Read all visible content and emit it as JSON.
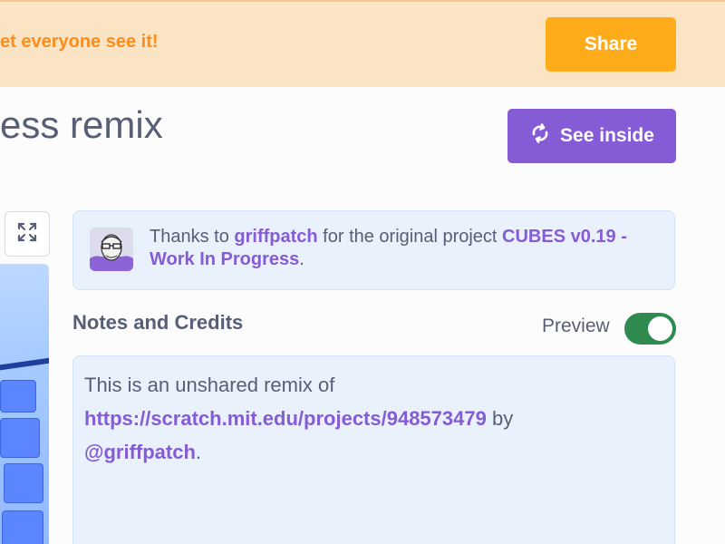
{
  "banner": {
    "message": "et everyone see it!",
    "share_label": "Share"
  },
  "project": {
    "title": "ess remix",
    "see_inside_label": "See inside"
  },
  "credit": {
    "prefix": "Thanks to ",
    "author": "griffpatch",
    "middle": " for the original project ",
    "original_project": "CUBES v0.19 - Work In Progress",
    "suffix": "."
  },
  "notes": {
    "heading": "Notes and Credits",
    "preview_label": "Preview",
    "preview_enabled": true,
    "text_prefix": "This is an unshared remix of ",
    "link": "https://scratch.mit.edu/projects/948573479",
    "text_middle": " by ",
    "mention": "@griffpatch",
    "text_suffix": "."
  },
  "colors": {
    "banner_bg": "#fbe4c4",
    "banner_text": "#ff8c1a",
    "share_button": "#ffab1a",
    "see_inside_button": "#855cd6",
    "link": "#855cd6",
    "toggle_on": "#2f8a4f",
    "box_bg": "#e9f1fc",
    "text": "#575e75"
  },
  "icons": {
    "see_inside": "remix-arrows-icon",
    "fullscreen": "fullscreen-icon"
  }
}
